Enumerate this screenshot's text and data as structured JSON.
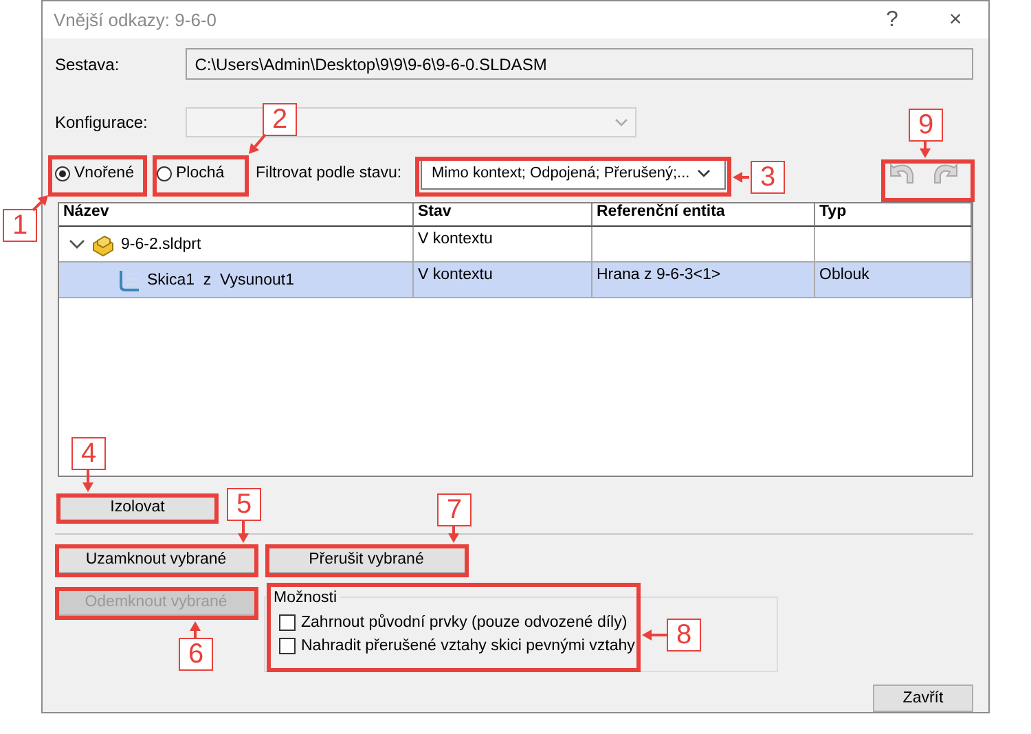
{
  "window": {
    "title": "Vnější odkazy: 9-6-0",
    "help": "?",
    "close": "×"
  },
  "assembly": {
    "label": "Sestava:",
    "value": "C:\\Users\\Admin\\Desktop\\9\\9\\9-6\\9-6-0.SLDASM"
  },
  "configuration": {
    "label": "Konfigurace:",
    "disabled": true
  },
  "view_mode": [
    {
      "label": "Vnořené",
      "selected": true
    },
    {
      "label": "Plochá",
      "selected": false
    }
  ],
  "filter": {
    "label": "Filtrovat podle stavu:",
    "value": "Mimo kontext; Odpojená; Přerušený;..."
  },
  "table": {
    "columns": [
      "Název",
      "Stav",
      "Referenční entita",
      "Typ"
    ],
    "rows": [
      {
        "name": "9-6-2.sldprt",
        "status": "V kontextu",
        "entity": "",
        "type": "",
        "expanded": true,
        "selected": false,
        "children": [
          {
            "name": "Skica1  z  Vysunout1",
            "status": "V kontextu",
            "entity": "Hrana z 9-6-3<1>",
            "type": "Oblouk",
            "selected": true
          }
        ]
      }
    ]
  },
  "isolate_button": {
    "label": "Izolovat",
    "disabled": false
  },
  "lock_buttons": [
    {
      "label": "Uzamknout vybrané",
      "disabled": false
    },
    {
      "label": "Přerušit vybrané",
      "disabled": false
    }
  ],
  "unlock_button": {
    "label": "Odemknout vybrané",
    "disabled": true
  },
  "options": {
    "title": "Možnosti",
    "items": [
      {
        "label": "Zahrnout původní prvky (pouze odvozené díly)",
        "checked": false
      },
      {
        "label": "Nahradit přerušené vztahy skici pevnými vztahy",
        "checked": false
      }
    ]
  },
  "close_button": {
    "label": "Zavřít"
  },
  "callouts": [
    {
      "label": "1"
    },
    {
      "label": "2"
    },
    {
      "label": "3"
    },
    {
      "label": "4"
    },
    {
      "label": "5"
    },
    {
      "label": "6"
    },
    {
      "label": "7"
    },
    {
      "label": "8"
    },
    {
      "label": "9"
    }
  ]
}
